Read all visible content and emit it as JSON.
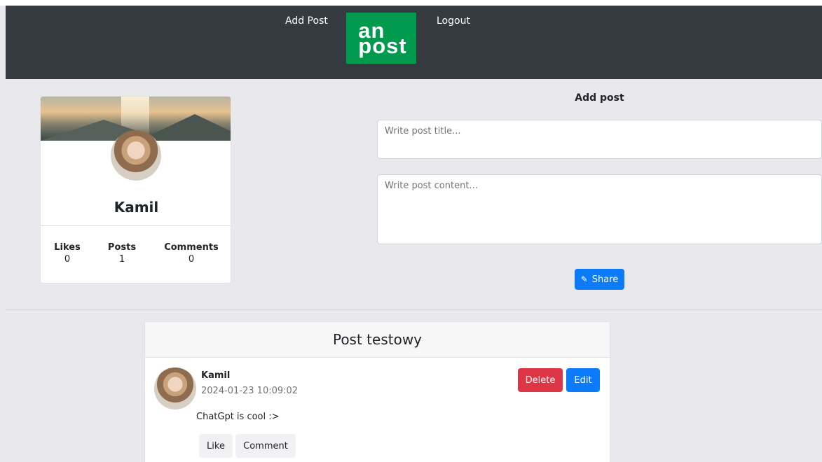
{
  "navbar": {
    "add_post": "Add Post",
    "logo_text": "an\npost",
    "logout": "Logout"
  },
  "profile": {
    "name": "Kamil",
    "stats": [
      {
        "label": "Likes",
        "value": "0"
      },
      {
        "label": "Posts",
        "value": "1"
      },
      {
        "label": "Comments",
        "value": "0"
      }
    ]
  },
  "add_post_form": {
    "heading": "Add post",
    "title_placeholder": "Write post title...",
    "content_placeholder": "Write post content...",
    "share_label": "Share",
    "share_icon": "pencil-icon"
  },
  "post": {
    "title": "Post testowy",
    "author": "Kamil",
    "date": "2024-01-23 10:09:02",
    "body": "ChatGpt is cool :>",
    "delete_label": "Delete",
    "edit_label": "Edit",
    "like_label": "Like",
    "comment_label": "Comment"
  },
  "colors": {
    "navbar": "#343a40",
    "logo_green": "#009a4e",
    "primary": "#0b7bfa",
    "danger": "#dc3545",
    "background": "#e9e8ed"
  }
}
